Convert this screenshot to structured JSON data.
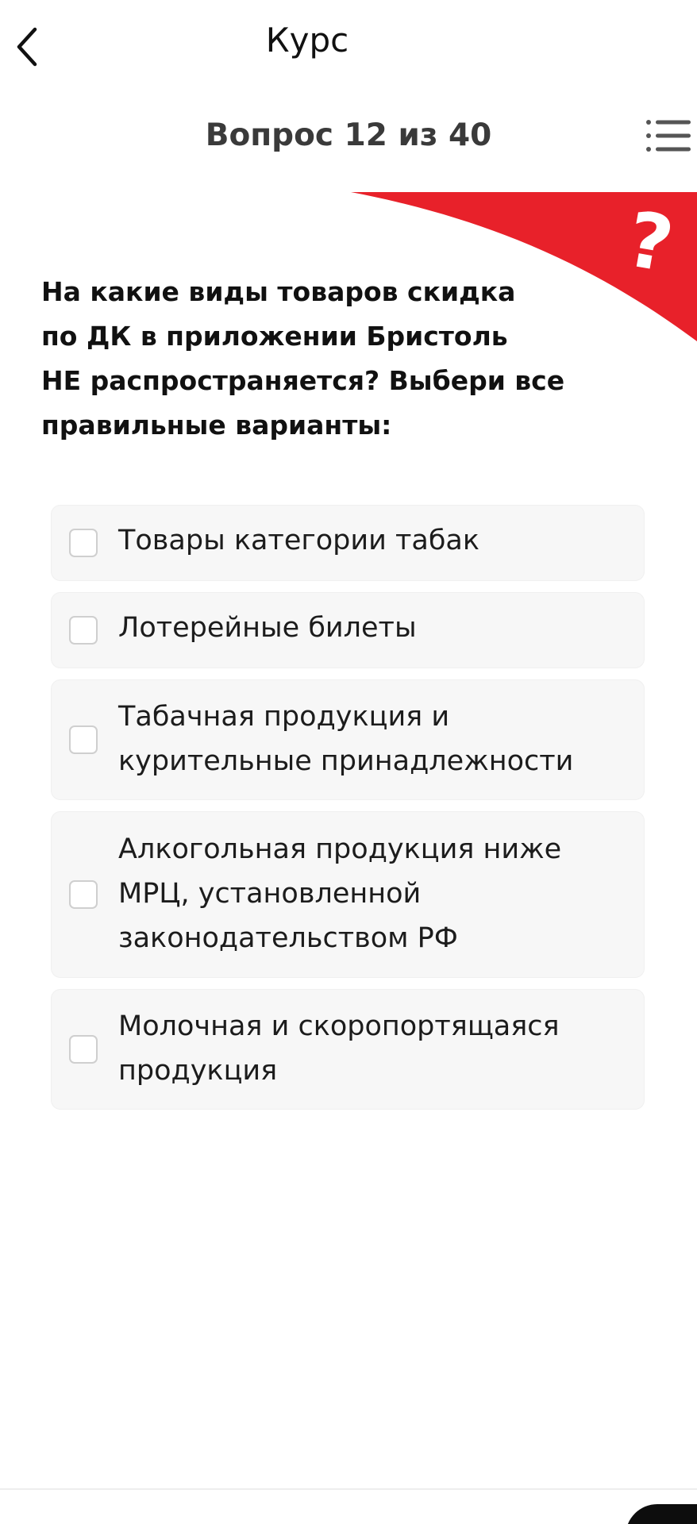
{
  "appbar": {
    "title": "Курс",
    "back_icon": "chevron-left-icon"
  },
  "header": {
    "counter": "Вопрос 12 из 40",
    "list_icon": "list-icon"
  },
  "banner": {
    "symbol": "?",
    "accent_color": "#e8212a"
  },
  "question": {
    "lines": [
      "На какие виды товаров скидка",
      "по ДК в приложении Бристоль",
      "НЕ распространяется? Выбери все",
      "правильные варианты:"
    ]
  },
  "options": [
    {
      "lines": [
        "Товары категории табак"
      ],
      "checked": false
    },
    {
      "lines": [
        "Лотерейные билеты"
      ],
      "checked": false
    },
    {
      "lines": [
        "Табачная продукция и",
        "курительные  принадлежности"
      ],
      "checked": false
    },
    {
      "lines": [
        "Алкогольная продукция ниже",
        "МРЦ, установленной",
        "законодательством РФ"
      ],
      "checked": false
    },
    {
      "lines": [
        "Молочная и скоропортящаяся",
        "продукция"
      ],
      "checked": false
    }
  ]
}
